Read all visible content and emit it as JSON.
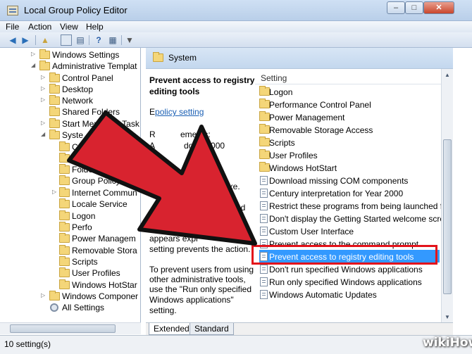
{
  "window": {
    "title": "Local Group Policy Editor",
    "min_label": "–",
    "max_label": "□",
    "close_label": "✕"
  },
  "menu": [
    "File",
    "Action",
    "View",
    "Help"
  ],
  "toolbar": {
    "icons": [
      "back-arrow-icon",
      "forward-arrow-icon",
      "up-folder-icon",
      "show-hide-tree-icon",
      "export-list-icon",
      "help-icon",
      "properties-icon",
      "filter-icon"
    ]
  },
  "tree": {
    "items": [
      {
        "label": "Windows Settings"
      },
      {
        "label": "Administrative Templat"
      },
      {
        "label": "Control Panel"
      },
      {
        "label": "Desktop"
      },
      {
        "label": "Network"
      },
      {
        "label": "Shared Folders"
      },
      {
        "label": "Start Menu and Task"
      },
      {
        "label": "Syste"
      },
      {
        "label": "C"
      },
      {
        "label": "D"
      },
      {
        "label": "Folder"
      },
      {
        "label": "Group Policy"
      },
      {
        "label": "Internet Commun"
      },
      {
        "label": "Locale Service"
      },
      {
        "label": "Logon"
      },
      {
        "label": "Perfo"
      },
      {
        "label": "Power Managem"
      },
      {
        "label": "Removable Stora"
      },
      {
        "label": "Scripts"
      },
      {
        "label": "User Profiles"
      },
      {
        "label": "Windows HotStar"
      },
      {
        "label": "Windows Componer"
      },
      {
        "label": "All Settings"
      }
    ]
  },
  "detail": {
    "header": "System",
    "title": "Prevent access to registry editing tools",
    "edit_prefix": "E",
    "edit_link": "policy setting",
    "fragments": [
      "R",
      "ements:",
      "A",
      "dows 2000",
      "ows",
      "dit.exe.",
      "nd",
      "appears expl",
      "setting prevents the action.",
      "To prevent users from using",
      "other administrative tools,",
      "use the \"Run only specified",
      "Windows applications\"",
      "setting."
    ]
  },
  "list": {
    "column": "Setting",
    "rows": [
      {
        "label": "Logon",
        "kind": "folder"
      },
      {
        "label": "Performance Control Panel",
        "kind": "folder"
      },
      {
        "label": "Power Management",
        "kind": "folder"
      },
      {
        "label": "Removable Storage Access",
        "kind": "folder"
      },
      {
        "label": "Scripts",
        "kind": "folder"
      },
      {
        "label": "User Profiles",
        "kind": "folder"
      },
      {
        "label": "Windows HotStart",
        "kind": "folder"
      },
      {
        "label": "Download missing COM components",
        "kind": "setting"
      },
      {
        "label": "Century interpretation for Year 2000",
        "kind": "setting"
      },
      {
        "label": "Restrict these programs from being launched fr...",
        "kind": "setting"
      },
      {
        "label": "Don't display the Getting Started welcome scre...",
        "kind": "setting"
      },
      {
        "label": "Custom User Interface",
        "kind": "setting"
      },
      {
        "label": "Prevent access to the command prompt",
        "kind": "setting"
      },
      {
        "label": "Prevent access to registry editing tools",
        "kind": "setting",
        "selected": true
      },
      {
        "label": "Don't run specified Windows applications",
        "kind": "setting"
      },
      {
        "label": "Run only specified Windows applications",
        "kind": "setting"
      },
      {
        "label": "Windows Automatic Updates",
        "kind": "setting"
      }
    ]
  },
  "tabs": [
    {
      "label": "Extended",
      "active": true
    },
    {
      "label": "Standard",
      "active": false
    }
  ],
  "status": "10 setting(s)",
  "watermark": "wikiHow",
  "colors": {
    "selection": "#3399ff",
    "highlight_box": "#e3131b",
    "arrow_fill": "#d8232f",
    "link": "#1a5fb4"
  }
}
